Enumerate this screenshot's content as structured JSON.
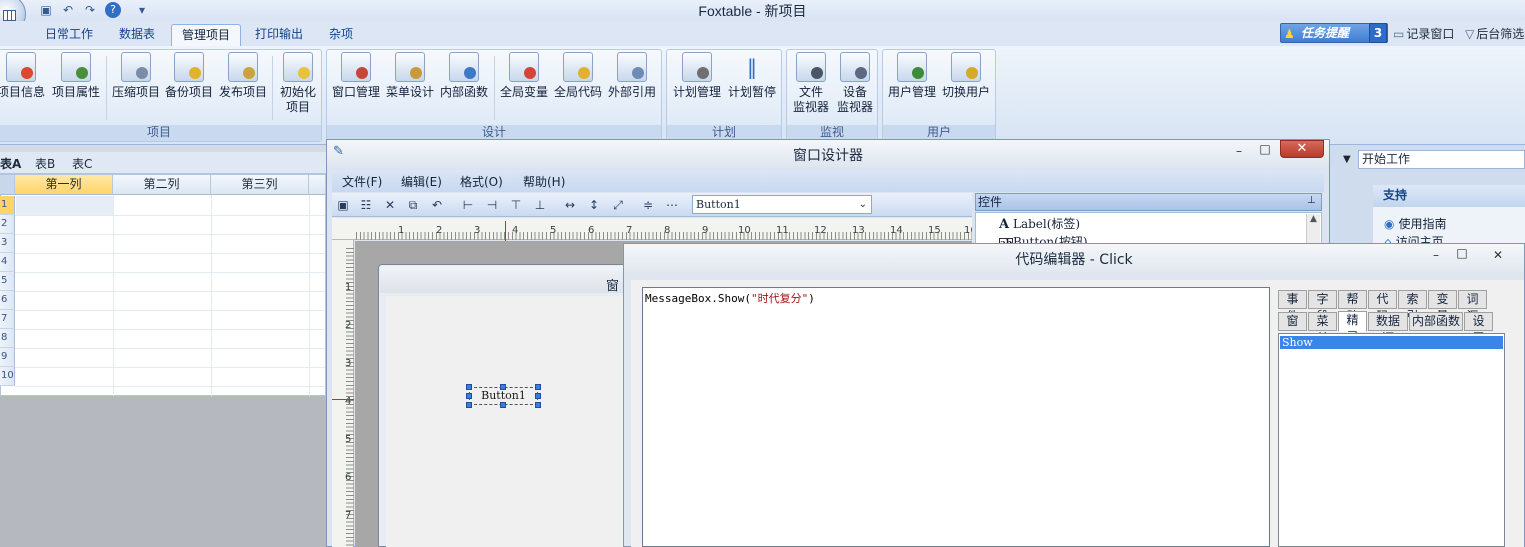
{
  "window_title": "Foxtable - 新项目",
  "quick_access": {
    "save_icon": "save-icon",
    "undo_icon": "undo-icon",
    "redo_icon": "redo-icon",
    "help_icon": "help-icon",
    "more": "▾"
  },
  "ribbon_tabs": [
    "日常工作",
    "数据表",
    "管理项目",
    "打印输出",
    "杂项"
  ],
  "active_tab": "管理项目",
  "top_right": {
    "task_reminder": "任务提醒",
    "task_count": "3",
    "record_window": "记录窗口",
    "background_filter": "后台筛选"
  },
  "groups": {
    "project": {
      "label": "项目",
      "buttons": [
        "项目信息",
        "项目属性",
        "压缩项目",
        "备份项目",
        "发布项目",
        "初始化",
        "项目"
      ]
    },
    "design": {
      "label": "设计",
      "buttons": [
        "窗口管理",
        "菜单设计",
        "内部函数",
        "全局变量",
        "全局代码",
        "外部引用"
      ]
    },
    "plan": {
      "label": "计划",
      "buttons": [
        "计划管理",
        "计划暂停"
      ]
    },
    "monitor": {
      "label": "监视",
      "buttons": [
        "文件",
        "监视器",
        "设备",
        "监视器"
      ]
    },
    "users": {
      "label": "用户",
      "buttons": [
        "用户管理",
        "切换用户"
      ]
    }
  },
  "sheet": {
    "tabs": [
      "表A",
      "表B",
      "表C"
    ],
    "columns": [
      "第一列",
      "第二列",
      "第三列"
    ],
    "rows": [
      "1",
      "2",
      "3",
      "4",
      "5",
      "6",
      "7",
      "8",
      "9",
      "10"
    ]
  },
  "task_pane": {
    "combo": "开始工作",
    "support_header": "支持",
    "links": [
      "使用指南",
      "访问主页"
    ]
  },
  "window_designer": {
    "title": "窗口设计器",
    "menus": [
      "文件(F)",
      "编辑(E)",
      "格式(O)",
      "帮助(H)"
    ],
    "control_combo": "Button1",
    "controls_header": "控件",
    "controls": [
      {
        "icon": "A",
        "label": "Label(标签)"
      },
      {
        "icon": "ab",
        "label": "Button(按钮)"
      }
    ],
    "ruler_top": [
      "1",
      "2",
      "3",
      "4",
      "5",
      "6",
      "7",
      "8",
      "9",
      "10",
      "11",
      "12",
      "13",
      "14",
      "15",
      "16"
    ],
    "ruler_left": [
      "1",
      "2",
      "3",
      "4",
      "5",
      "6",
      "7"
    ],
    "form_title": "窗",
    "button_label": "Button1"
  },
  "code_editor": {
    "title": "代码编辑器 - Click",
    "code_prefix": "MessageBox.Show(",
    "code_string": "\"时代复分\"",
    "code_suffix": ")",
    "tabs_row1": [
      "事件",
      "字段",
      "帮助",
      "代码",
      "索引",
      "变量",
      "词汇"
    ],
    "tabs_row2": [
      "窗口",
      "菜单",
      "精灵",
      "数据源",
      "内部函数",
      "设置"
    ],
    "active_tab": "精灵",
    "intellisense_item": "Show"
  },
  "caption_buttons": {
    "minimize": "–",
    "maximize": "□",
    "close": "✕"
  },
  "colors": {
    "ribbon": "#dce6f4",
    "accent": "#3a86e8",
    "selection": "#ffd36a",
    "close": "#c44a3b"
  }
}
